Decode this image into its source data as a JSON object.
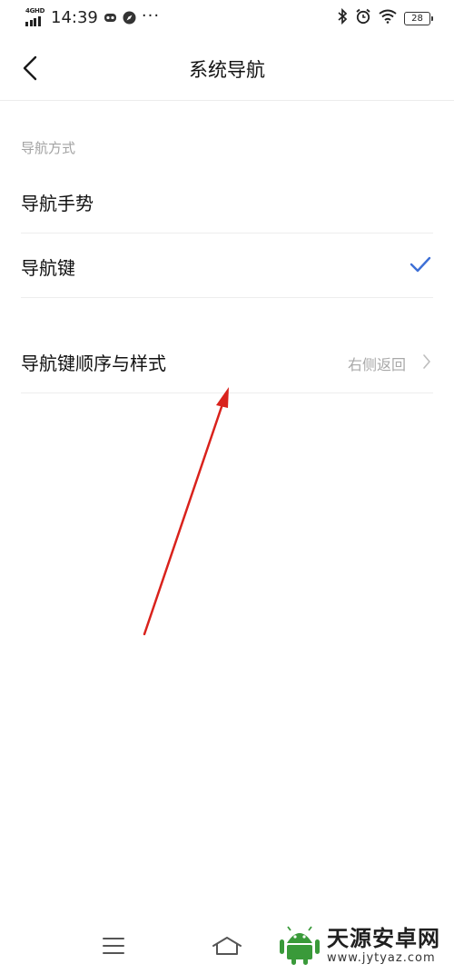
{
  "status_bar": {
    "network": "4GHD",
    "time": "14:39",
    "dots": "···",
    "battery": "28"
  },
  "header": {
    "title": "系统导航"
  },
  "section": {
    "label": "导航方式"
  },
  "options": [
    {
      "label": "导航手势",
      "selected": false
    },
    {
      "label": "导航键",
      "selected": true
    }
  ],
  "settings_row": {
    "label": "导航键顺序与样式",
    "value": "右侧返回"
  },
  "watermark": {
    "title": "天源安卓网",
    "url": "www.jytyaz.com"
  },
  "colors": {
    "accent": "#3d6fd6",
    "annotation_arrow": "#d9221c",
    "watermark_green": "#3a9a3a"
  }
}
